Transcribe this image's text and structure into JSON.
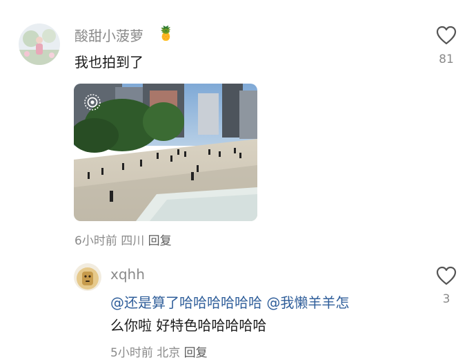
{
  "comment1": {
    "username": "酸甜小菠萝",
    "badge_emoji": "🍍",
    "text": "我也拍到了",
    "like_count": "81",
    "meta": {
      "time": "6小时前",
      "location": "四川",
      "reply_label": "回复"
    },
    "photo_icon": "live-photo-icon"
  },
  "comment2": {
    "username": "xqhh",
    "like_count": "3",
    "text_parts": {
      "mention1": "@",
      "part1": "还是算了哈哈哈哈哈哈",
      "mention2": "@我懒羊羊怎",
      "part2": "么你啦 好特色哈哈哈哈哈"
    },
    "meta": {
      "time": "5小时前",
      "location": "北京",
      "reply_label": "回复"
    }
  },
  "colors": {
    "mention": "#2f5e9a",
    "muted": "#8a8a8a",
    "text": "#1a1a1a"
  }
}
